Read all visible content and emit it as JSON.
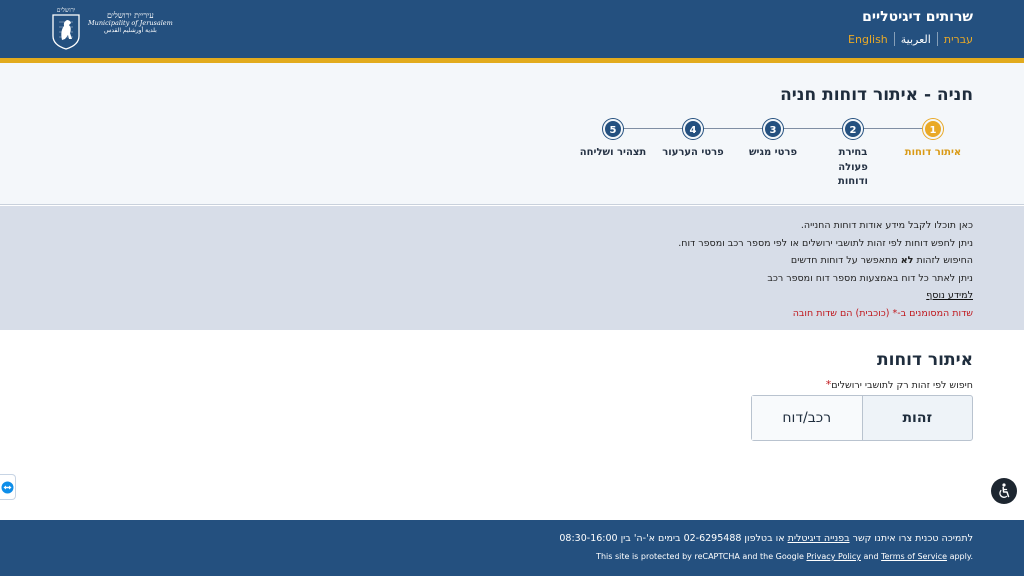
{
  "header": {
    "site_title": "שרותים דיגיטליים",
    "languages": [
      "עברית",
      "العربية",
      "English"
    ],
    "logo": {
      "hebrew": "עיריית ירושלים",
      "english": "Municipality of Jerusalem",
      "arabic": "بلدية أورشليم القدس",
      "emblem_text": "ירושלים"
    }
  },
  "page": {
    "title": "חניה - איתור דוחות חניה"
  },
  "stepper": {
    "steps": [
      {
        "number": "1",
        "label": "איתור דוחות",
        "active": true
      },
      {
        "number": "2",
        "label": "בחירת פעולה ודוחות",
        "active": false
      },
      {
        "number": "3",
        "label": "פרטי מגיש",
        "active": false
      },
      {
        "number": "4",
        "label": "פרטי הערעור",
        "active": false
      },
      {
        "number": "5",
        "label": "תצהיר ושליחה",
        "active": false
      }
    ]
  },
  "info": {
    "line1": "כאן תוכלו לקבל מידע אודות דוחות החנייה.",
    "line2": "ניתן לחפש דוחות לפי זהות לתושבי ירושלים או לפי מספר רכב ומספר דוח.",
    "line3_before": "החיפוש לזהות ",
    "line3_bold": "לא",
    "line3_after": " מתאפשר על דוחות חדשים",
    "line4": "ניתן לאתר כל דוח באמצעות מספר דוח ומספר רכב",
    "more_info_link": "למידע נוסף",
    "required_note": "שדות המסומנים ב-* (כוכבית) הם שדות חובה"
  },
  "search": {
    "title": "איתור דוחות",
    "subtitle": "חיפוש לפי זהות רק לתושבי ירושלים",
    "required_mark": "*",
    "tabs": [
      "זהות",
      "רכב/דוח"
    ]
  },
  "footer": {
    "line1_before": "לתמיכה טכנית צרו איתנו קשר ",
    "line1_link": "בפנייה דיגיטלית",
    "line1_after": " או בטלפון 02-6295488 בימים א'-ה' בין 08:30-16:00",
    "recaptcha_before": "This site is protected by reCAPTCHA and the Google ",
    "privacy_link": "Privacy Policy",
    "recaptcha_and": " and ",
    "terms_link": "Terms of Service",
    "recaptcha_after": " apply."
  },
  "colors": {
    "header_blue": "#24507f",
    "gold": "#e2ab1e",
    "step_active": "#e9a927",
    "required_red": "#c0161b"
  },
  "icons": [
    "jerusalem-emblem-icon",
    "accessibility-icon",
    "teamviewer-icon"
  ]
}
